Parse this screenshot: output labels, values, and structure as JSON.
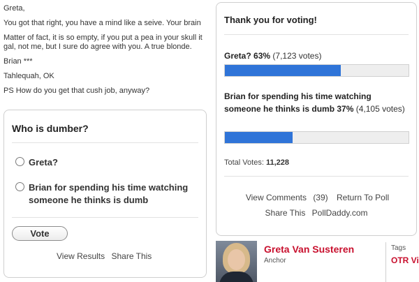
{
  "letter": {
    "greeting": "Greta,",
    "line1": "You got that right, you have a mind like a seive. Your brain",
    "line2a": "Matter of fact, it is so empty, if you put a pea in your skull it",
    "line2b": "gal, not me, but I sure do agree with you. A true blonde.",
    "signature": "Brian ***",
    "location": "Tahlequah, OK",
    "ps": "PS How do you get that cush job, anyway?"
  },
  "poll": {
    "question": "Who is dumber?",
    "options": [
      {
        "label": "Greta?"
      },
      {
        "label": "Brian for spending his time watching someone he thinks is dumb"
      }
    ],
    "vote_label": "Vote",
    "view_results": "View Results",
    "share": "Share This"
  },
  "results": {
    "title": "Thank you for voting!",
    "items": [
      {
        "name": "Greta?",
        "percent_text": "63%",
        "votes_text": "(7,123 votes)",
        "fraction": 0.63
      },
      {
        "name": "Brian for spending his time watching someone he thinks is dumb",
        "percent_text": "37%",
        "votes_text": "(4,105 votes)",
        "fraction": 0.37
      }
    ],
    "total_label": "Total Votes:",
    "total_value": "11,228",
    "view_comments": "View Comments",
    "comments_count": "(39)",
    "return_to_poll": "Return To Poll",
    "share": "Share This",
    "polldaddy": "PollDaddy.com",
    "bar_color": "#2f74d8"
  },
  "host": {
    "name": "Greta Van Susteren",
    "role": "Anchor",
    "tags_label": "Tags",
    "tags_value": "OTR Vie"
  }
}
